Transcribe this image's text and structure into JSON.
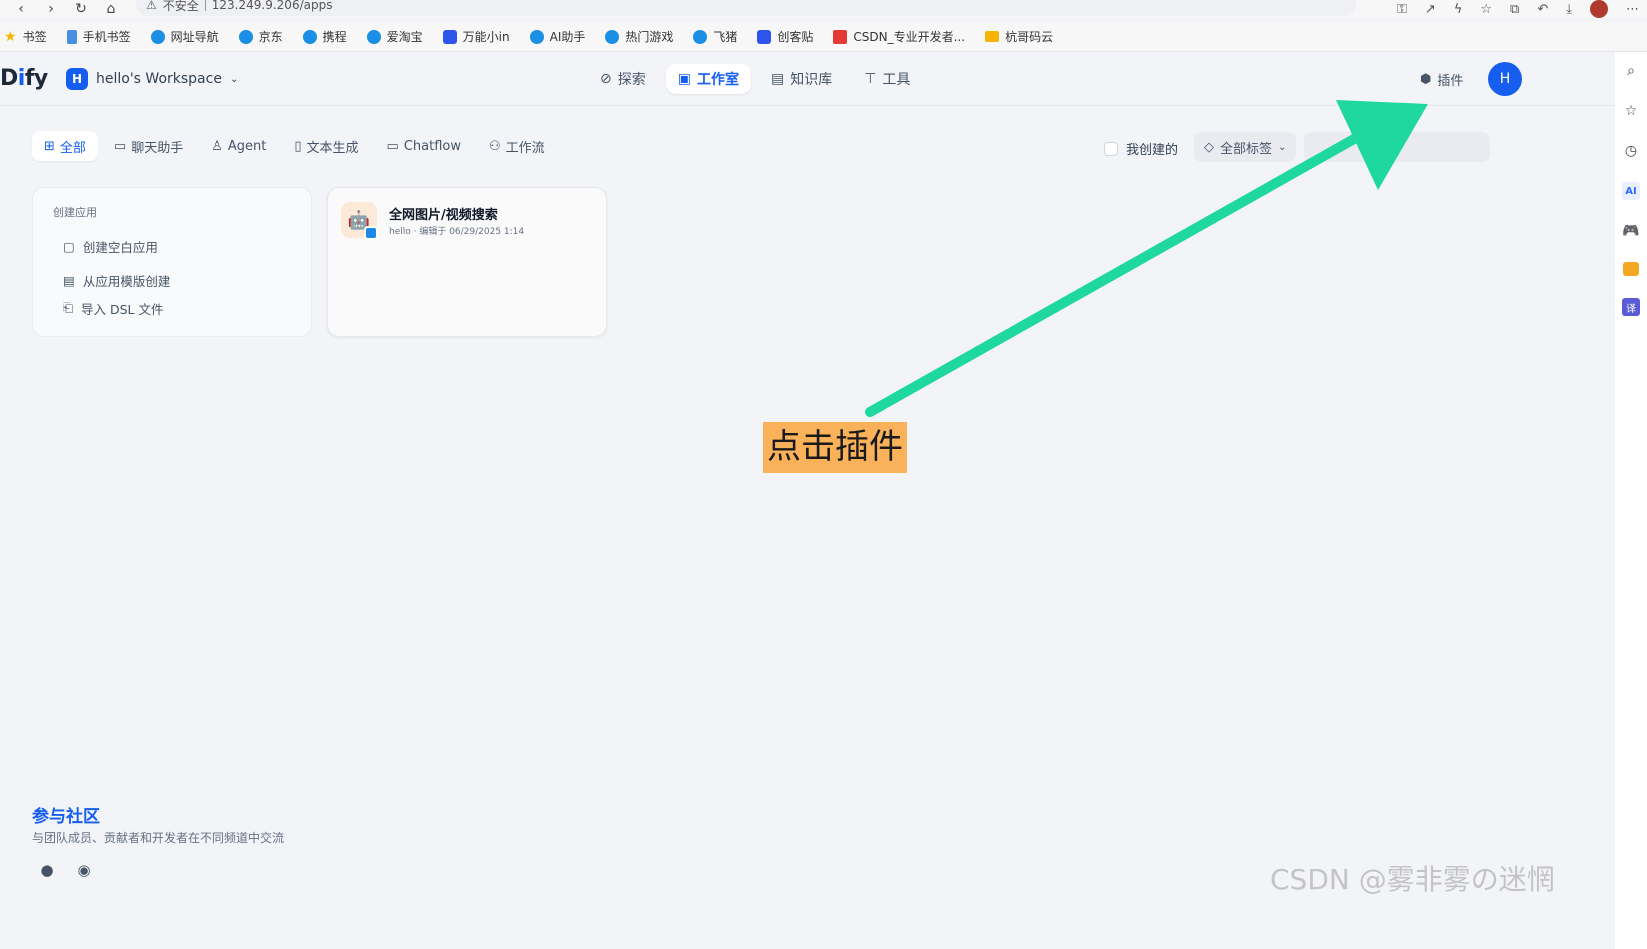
{
  "browser": {
    "security_label": "不安全",
    "url": "123.249.9.206/apps",
    "bookmarks": [
      {
        "label": "书签",
        "icon": "star-icon"
      },
      {
        "label": "手机书签",
        "icon": "bookmark-icon"
      },
      {
        "label": "网址导航",
        "icon": "ie-icon"
      },
      {
        "label": "京东",
        "icon": "ie-icon"
      },
      {
        "label": "携程",
        "icon": "ie-icon"
      },
      {
        "label": "爱淘宝",
        "icon": "ie-icon"
      },
      {
        "label": "万能小in",
        "icon": "robot-icon"
      },
      {
        "label": "AI助手",
        "icon": "ie-icon"
      },
      {
        "label": "热门游戏",
        "icon": "ie-icon"
      },
      {
        "label": "飞猪",
        "icon": "ie-icon"
      },
      {
        "label": "创客贴",
        "icon": "shield-icon"
      },
      {
        "label": "CSDN_专业开发者...",
        "icon": "csdn-icon"
      },
      {
        "label": "杭哥码云",
        "icon": "folder-icon"
      }
    ]
  },
  "header": {
    "logo_prefix": "D",
    "logo_i": "i",
    "logo_suffix": "fy",
    "workspace_initial": "H",
    "workspace_name": "hello's Workspace",
    "nav": [
      {
        "label": "探索",
        "icon": "compass-icon",
        "active": false
      },
      {
        "label": "工作室",
        "icon": "robot-icon",
        "active": true
      },
      {
        "label": "知识库",
        "icon": "book-icon",
        "active": false
      },
      {
        "label": "工具",
        "icon": "hammer-icon",
        "active": false
      }
    ],
    "plugin_label": "插件",
    "user_initial": "H"
  },
  "filters": {
    "tabs": [
      {
        "label": "全部",
        "icon": "grid-icon",
        "active": true
      },
      {
        "label": "聊天助手",
        "icon": "chat-icon",
        "active": false
      },
      {
        "label": "Agent",
        "icon": "agent-icon",
        "active": false
      },
      {
        "label": "文本生成",
        "icon": "doc-icon",
        "active": false
      },
      {
        "label": "Chatflow",
        "icon": "chatflow-icon",
        "active": false
      },
      {
        "label": "工作流",
        "icon": "workflow-icon",
        "active": false
      }
    ],
    "mine_label": "我创建的",
    "tags_label": "全部标签",
    "search_value": ""
  },
  "create_card": {
    "title": "创建应用",
    "items": [
      "创建空白应用",
      "从应用模版创建",
      "导入 DSL 文件"
    ]
  },
  "app_card": {
    "name": "全网图片/视频搜索",
    "meta": "hello · 编辑于 06/29/2025 1:14"
  },
  "community": {
    "title": "参与社区",
    "desc": "与团队成员、贡献者和开发者在不同频道中交流"
  },
  "annotation": {
    "label": "点击插件",
    "arrow_color": "#1ed8a0"
  },
  "watermark": "CSDN @雾非雾の迷惘"
}
